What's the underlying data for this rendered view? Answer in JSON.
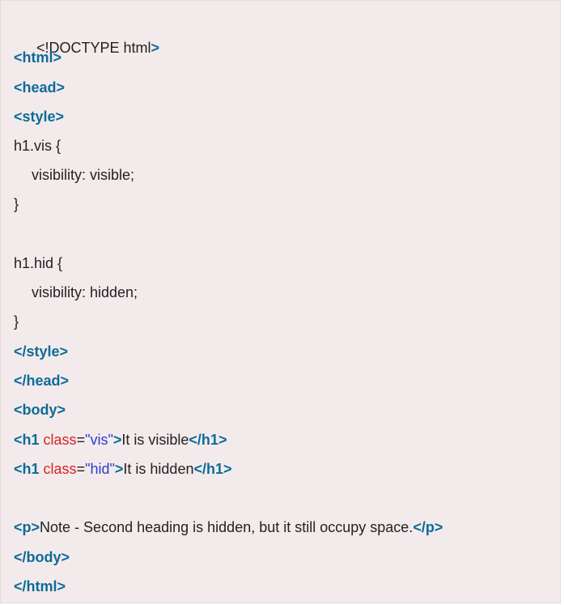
{
  "code": {
    "doctype_text": "<!DOCTYPE html",
    "lt": "<",
    "gt": ">",
    "lt_slash": "</",
    "tags": {
      "html": "html",
      "head": "head",
      "style": "style",
      "body": "body",
      "h1": "h1",
      "p": "p"
    },
    "css": {
      "sel_vis": "h1.vis {",
      "decl_vis": "visibility: visible;",
      "sel_hid": "h1.hid {",
      "decl_hid": "visibility: hidden;",
      "close_brace": "}"
    },
    "attr_name": "class",
    "equals": "=",
    "val_vis": "\"vis\"",
    "val_hid": "\"hid\"",
    "text_visible": "It is visible",
    "text_hidden": "It is hidden",
    "text_note": "Note - Second heading is hidden, but it still occupy space."
  },
  "colors": {
    "background": "#f3ebeb",
    "tag": "#0d6b9a",
    "attribute": "#d8232a",
    "value": "#2e3cd2",
    "text": "#222222"
  }
}
